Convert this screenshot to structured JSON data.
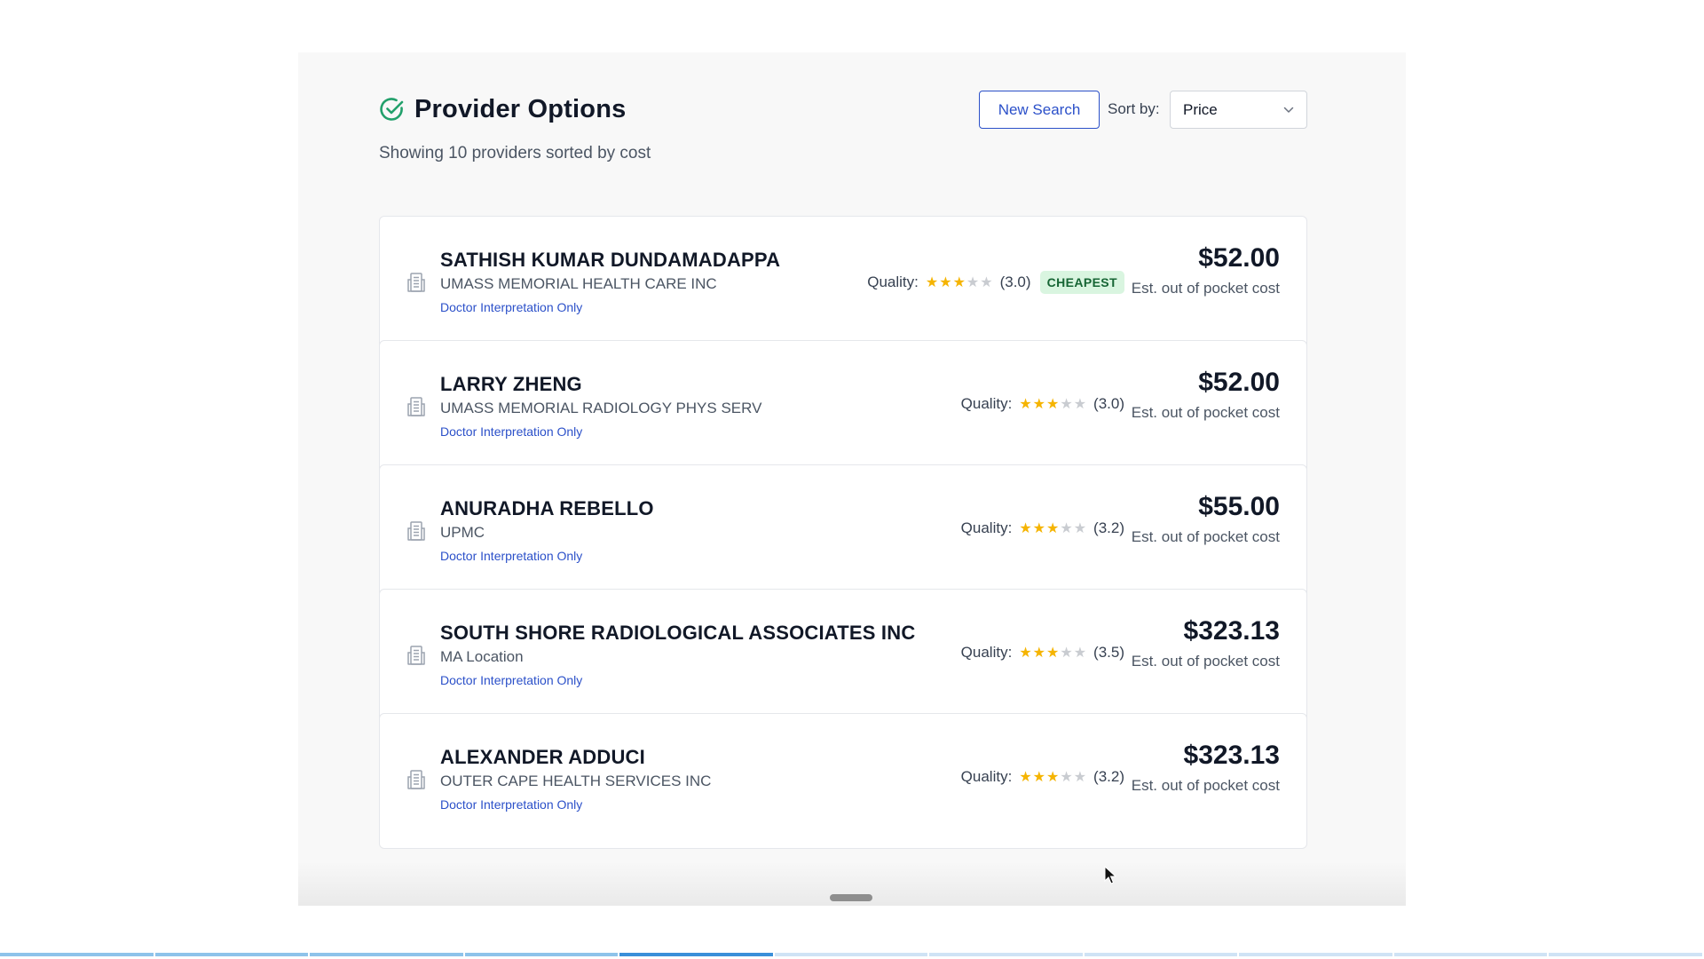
{
  "header": {
    "title": "Provider Options",
    "new_search_label": "New Search",
    "sort_label": "Sort by:",
    "sort_value": "Price"
  },
  "subtitle": "Showing 10 providers sorted by cost",
  "quality_label": "Quality:",
  "price_caption": "Est. out of pocket cost",
  "providers": [
    {
      "name": "SATHISH KUMAR DUNDAMADAPPA",
      "org": "UMASS MEMORIAL HEALTH CARE INC",
      "link": "Doctor Interpretation Only",
      "rating": 3.0,
      "rating_text": "(3.0)",
      "badge": "CHEAPEST",
      "price": "$52.00"
    },
    {
      "name": "LARRY ZHENG",
      "org": "UMASS MEMORIAL RADIOLOGY PHYS SERV",
      "link": "Doctor Interpretation Only",
      "rating": 3.0,
      "rating_text": "(3.0)",
      "badge": "",
      "price": "$52.00"
    },
    {
      "name": "ANURADHA REBELLO",
      "org": "UPMC",
      "link": "Doctor Interpretation Only",
      "rating": 3.2,
      "rating_text": "(3.2)",
      "badge": "",
      "price": "$55.00"
    },
    {
      "name": "SOUTH SHORE RADIOLOGICAL ASSOCIATES INC",
      "org": "MA Location",
      "link": "Doctor Interpretation Only",
      "rating": 3.5,
      "rating_text": "(3.5)",
      "badge": "",
      "price": "$323.13"
    },
    {
      "name": "ALEXANDER ADDUCI",
      "org": "OUTER CAPE HEALTH SERVICES INC",
      "link": "Doctor Interpretation Only",
      "rating": 3.2,
      "rating_text": "(3.2)",
      "badge": "",
      "price": "$323.13"
    }
  ],
  "progress": {
    "segments": 11,
    "completed": 4,
    "current": 5
  },
  "colors": {
    "accent": "#2b50c9",
    "check": "#22a06b",
    "star": "#f5b400",
    "badge_bg": "#d9f5e0",
    "badge_text": "#166534"
  },
  "icons": {
    "title": "check-circle-icon",
    "provider": "building-icon",
    "sort": "chevron-down-icon"
  }
}
